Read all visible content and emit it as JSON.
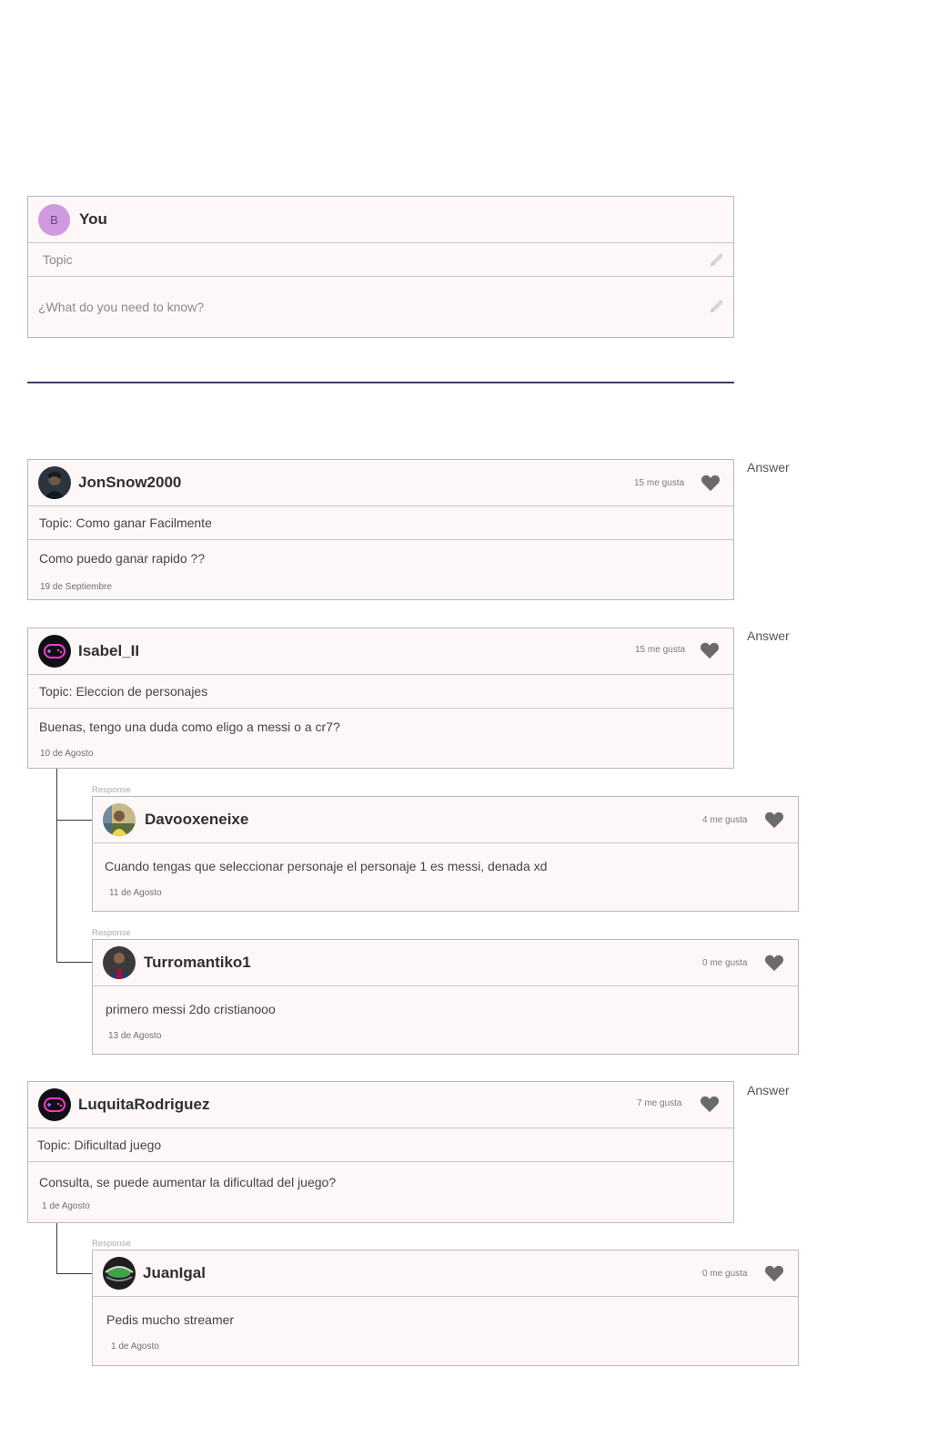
{
  "composer": {
    "avatar_letter": "B",
    "user_name": "You",
    "topic_placeholder": "Topic",
    "question_placeholder": "¿What do you need to know?"
  },
  "threads": [
    {
      "user": "JonSnow2000",
      "likes": "15 me gusta",
      "topic": "Topic: Como ganar Facilmente",
      "text": "Como puedo ganar rapido ??",
      "date": "19 de Septiembre",
      "answer_label": "Answer",
      "avatar": "jonsnow-avatar"
    },
    {
      "user": "Isabel_II",
      "likes": "15 me gusta",
      "topic": "Topic: Eleccion de personajes",
      "text": "Buenas, tengo una duda como eligo a messi o a cr7?",
      "date": "10 de Agosto",
      "answer_label": "Answer",
      "avatar": "gamepad-neon-avatar",
      "responses": [
        {
          "label": "Response",
          "user": "Davooxeneixe",
          "likes": "4 me gusta",
          "text": "Cuando tengas que seleccionar personaje el personaje 1 es messi, denada xd",
          "date": "11 de Agosto",
          "avatar": "player-photo-avatar"
        },
        {
          "label": "Response",
          "user": "Turromantiko1",
          "likes": "0 me gusta",
          "text": "primero messi 2do cristianooo",
          "date": "13 de Agosto",
          "avatar": "barca-player-avatar"
        }
      ]
    },
    {
      "user": "LuquitaRodriguez",
      "likes": "7 me gusta",
      "topic": "Topic: Dificultad juego",
      "text": "Consulta, se puede aumentar la dificultad del juego?",
      "date": "1 de Agosto",
      "answer_label": "Answer",
      "avatar": "gamepad-neon-avatar",
      "responses": [
        {
          "label": "Response",
          "user": "JuanIgal",
          "likes": "0 me gusta",
          "text": "Pedis mucho streamer",
          "date": "1 de Agosto",
          "avatar": "stadium-avatar"
        }
      ]
    }
  ],
  "colors": {
    "card_bg": "#fdf8f7",
    "composer_avatar": "#d09ae0",
    "divider": "#3f3d6b",
    "heart": "#6a6a6a"
  }
}
